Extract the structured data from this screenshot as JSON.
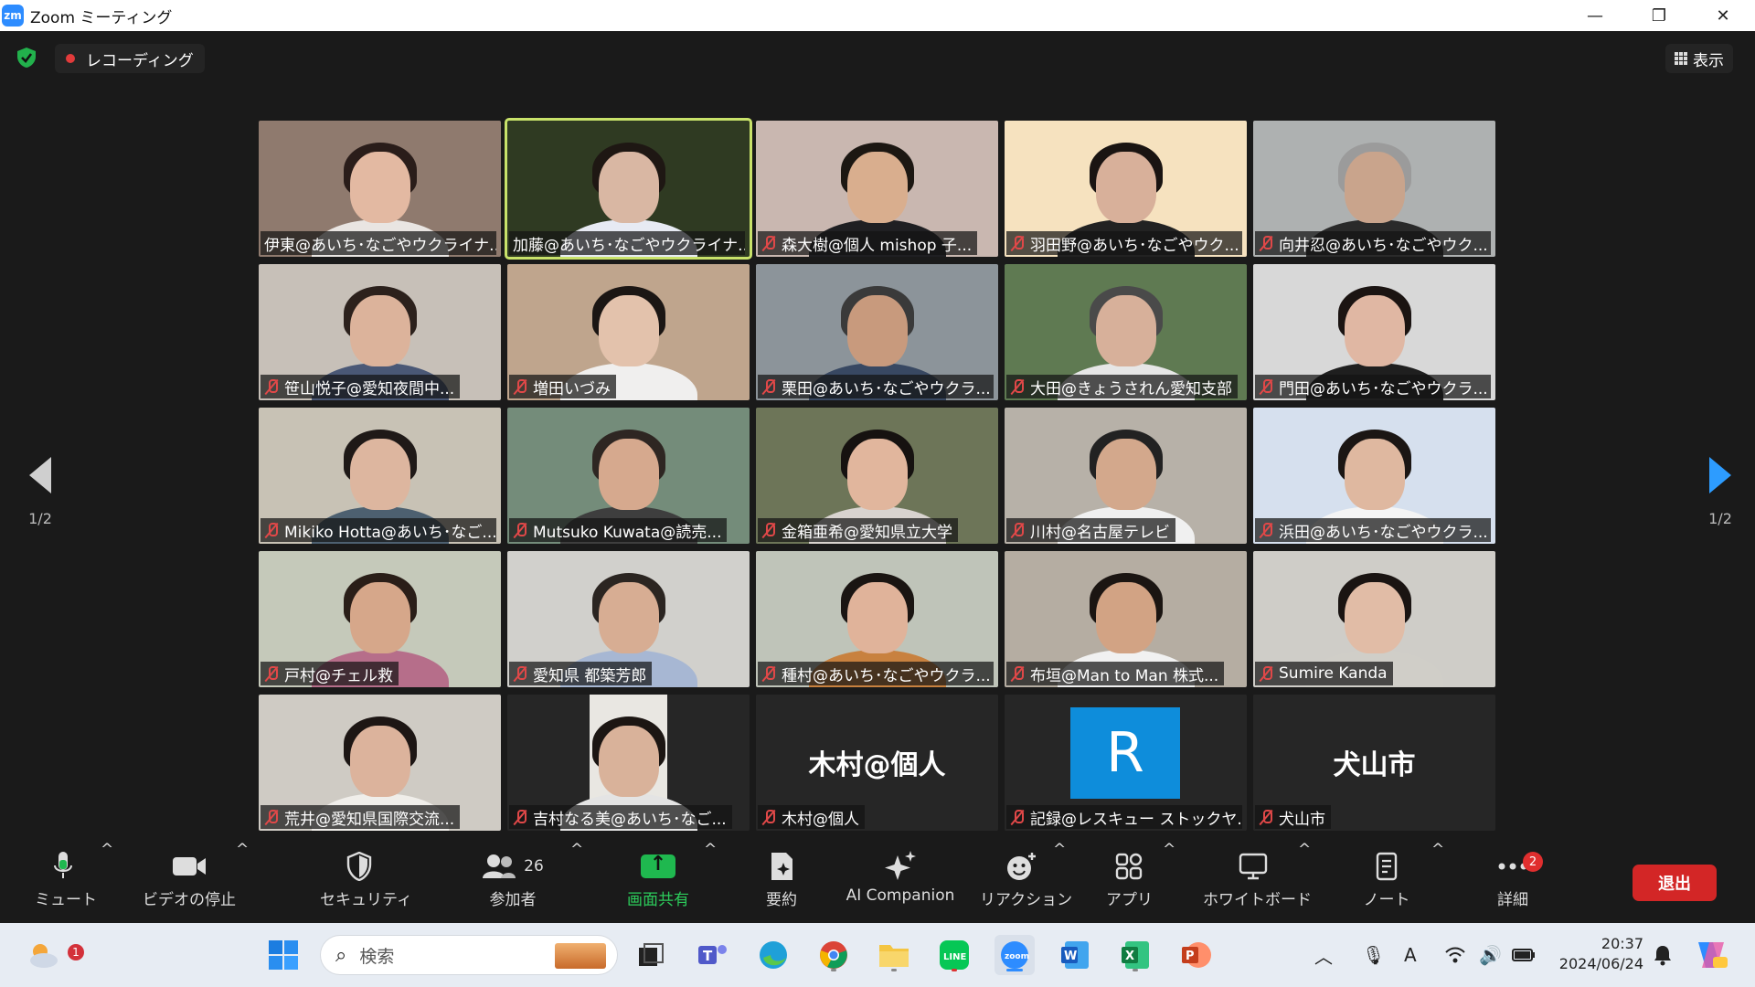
{
  "window": {
    "app_title": "Zoom ミーティング",
    "minimize": "—",
    "maximize": "❐",
    "close": "✕"
  },
  "topbar": {
    "recording_label": "レコーディング",
    "view_label": "表示"
  },
  "pager": {
    "left": "1/2",
    "right": "1/2"
  },
  "participants": [
    {
      "name": "伊東@あいち･なごやウクライナ...",
      "muted": false,
      "bg": "#8f7a6e",
      "skin": "#e3b9a2",
      "hair": "#2a1d1a",
      "shirt": "#e9e5e2"
    },
    {
      "name": "加藤@あいち･なごやウクライナ...",
      "muted": false,
      "active": true,
      "bg": "#2f3a22",
      "skin": "#d9b7a3",
      "hair": "#1e1713",
      "shirt": "#e7eaf3"
    },
    {
      "name": "森大樹@個人 mishop 子...",
      "muted": true,
      "bg": "#c9b7b0",
      "skin": "#d9ae8e",
      "hair": "#1c1712",
      "shirt": "#1f1f22"
    },
    {
      "name": "羽田野@あいち･なごやウク...",
      "muted": true,
      "bg": "#f6e2bf",
      "skin": "#d8b09a",
      "hair": "#1a1412",
      "shirt": "#222222"
    },
    {
      "name": "向井忍@あいち･なごやウク...",
      "muted": true,
      "bg": "#aeb1b1",
      "skin": "#c9a48c",
      "hair": "#9b9b9b",
      "shirt": "#2a2a2a"
    },
    {
      "name": "笹山悦子@愛知夜間中...",
      "muted": true,
      "bg": "#c7c0b8",
      "skin": "#dcb39b",
      "hair": "#2c211c",
      "shirt": "#4a5876"
    },
    {
      "name": "増田いづみ",
      "muted": true,
      "bg": "#bfa58d",
      "skin": "#e3c2ac",
      "hair": "#1b1614",
      "shirt": "#f0efee"
    },
    {
      "name": "栗田@あいち･なごやウクラ...",
      "muted": true,
      "bg": "#8c949a",
      "skin": "#c89a7d",
      "hair": "#3a3a3a",
      "shirt": "#384862"
    },
    {
      "name": "大田@きょうされん愛知支部",
      "muted": true,
      "bg": "#5f7a52",
      "skin": "#d7b09a",
      "hair": "#4a4a4a",
      "shirt": "#e6e6e6"
    },
    {
      "name": "門田@あいち･なごやウクラ...",
      "muted": true,
      "bg": "#d8d8d8",
      "skin": "#e0b7a3",
      "hair": "#1b1412",
      "shirt": "#1f1f1f"
    },
    {
      "name": "Mikiko Hotta@あいち･なご...",
      "muted": true,
      "bg": "#c8c2b5",
      "skin": "#ddb69f",
      "hair": "#1f1917",
      "shirt": "#4d6070"
    },
    {
      "name": "Mutsuko Kuwata@読売...",
      "muted": true,
      "bg": "#748c7a",
      "skin": "#d6a98e",
      "hair": "#2e2622",
      "shirt": "#3e3e3e"
    },
    {
      "name": "金箱亜希@愛知県立大学",
      "muted": true,
      "bg": "#6d7558",
      "skin": "#e1b69d",
      "hair": "#161210",
      "shirt": "#d8d3cf"
    },
    {
      "name": "川村@名古屋テレビ",
      "muted": true,
      "bg": "#b7b1a8",
      "skin": "#d3a88c",
      "hair": "#222222",
      "shirt": "#f0f0f0"
    },
    {
      "name": "浜田@あいち･なごやウクラ...",
      "muted": true,
      "bg": "#d6e0ee",
      "skin": "#dfb8a0",
      "hair": "#1b1614",
      "shirt": "#f4f4f4"
    },
    {
      "name": "戸村@チェル救",
      "muted": true,
      "bg": "#c5c9ba",
      "skin": "#d6a78a",
      "hair": "#2a1e18",
      "shirt": "#b66e8a"
    },
    {
      "name": "愛知県 都築芳郎",
      "muted": true,
      "bg": "#d1d0cc",
      "skin": "#d7ad93",
      "hair": "#2b2521",
      "shirt": "#a7b7d3"
    },
    {
      "name": "種村@あいち･なごやウクラ...",
      "muted": true,
      "bg": "#bfc4b9",
      "skin": "#e0b39a",
      "hair": "#1a1512",
      "shirt": "#c8813f"
    },
    {
      "name": "布垣@Man to Man 株式...",
      "muted": true,
      "bg": "#b5ada2",
      "skin": "#d2a384",
      "hair": "#1b1512",
      "shirt": "#f1f1f1"
    },
    {
      "name": "Sumire Kanda",
      "muted": true,
      "bg": "#cfcdc8",
      "skin": "#e1bca6",
      "hair": "#1a1412",
      "shirt": "#d0cec8"
    },
    {
      "name": "荒井@愛知県国際交流...",
      "muted": true,
      "bg": "#cfcbc4",
      "skin": "#dcb39c",
      "hair": "#1d1614",
      "shirt": "#f0eeea"
    },
    {
      "name": "吉村なる美@あいち･なご...",
      "muted": true,
      "bg": "#262626",
      "skin": "#d9b29a",
      "hair": "#1c1613",
      "shirt": "#e4e4e4",
      "narrow": true
    },
    {
      "name": "木村@個人",
      "muted": true,
      "bg": "#262626",
      "display": "木村@個人"
    },
    {
      "name": "記録@レスキュー ストックヤ...",
      "muted": true,
      "bg": "#262626",
      "avatar": "R"
    },
    {
      "name": "犬山市",
      "muted": true,
      "bg": "#262626",
      "display": "犬山市"
    }
  ],
  "toolbar": {
    "mute": "ミュート",
    "video": "ビデオの停止",
    "security": "セキュリティ",
    "participants": "参加者",
    "participant_count": "26",
    "share": "画面共有",
    "summary": "要約",
    "ai": "AI Companion",
    "reactions": "リアクション",
    "apps": "アプリ",
    "whiteboard": "ホワイトボード",
    "notes": "ノート",
    "more": "詳細",
    "more_badge": "2",
    "leave": "退出",
    "caret": "^"
  },
  "taskbar": {
    "search_placeholder": "検索",
    "weather_badge": "1",
    "time": "20:37",
    "date": "2024/06/24",
    "ime": "A",
    "colors": {
      "accent": "#2D8CFF",
      "share": "#1fb84f",
      "leave": "#d32626"
    }
  }
}
